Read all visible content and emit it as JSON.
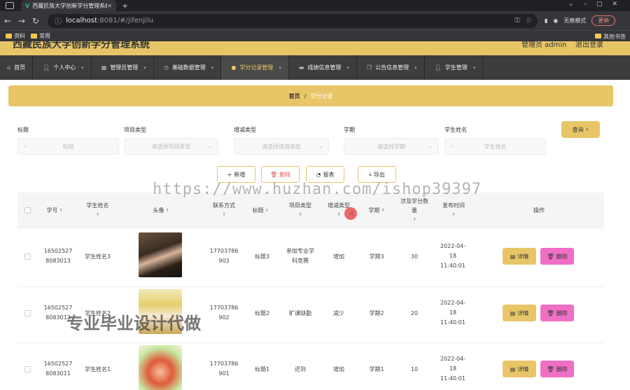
{
  "browser": {
    "tab_title": "西藏民族大学创新学分管理系统",
    "url_host": "localhost",
    "url_rest": ":8081/#/jifenjilu",
    "incognito": "无痕模式",
    "update": "更新",
    "bookmarks": [
      "资料",
      "常用"
    ],
    "other_bookmarks": "其他书签"
  },
  "header": {
    "title": "西藏民族大学创新学分管理系统",
    "user": "管理员 admin",
    "logout": "退出登录"
  },
  "menu": [
    {
      "icon": "home-icon",
      "label": "首页"
    },
    {
      "icon": "person-icon",
      "label": "个人中心"
    },
    {
      "icon": "grid-icon",
      "label": "管理员管理"
    },
    {
      "icon": "clock-icon",
      "label": "基础数据管理"
    },
    {
      "icon": "pin-icon",
      "label": "学分记录管理",
      "active": true
    },
    {
      "icon": "box-icon",
      "label": "成绩信息管理"
    },
    {
      "icon": "copy-icon",
      "label": "公告信息管理"
    },
    {
      "icon": "person-icon",
      "label": "学生管理"
    }
  ],
  "breadcrumb": {
    "home": "首页",
    "sep": "/",
    "current": "学分记录"
  },
  "filters": {
    "title_label": "标题",
    "title_ph": "标题",
    "type_label": "项目类型",
    "type_ph": "请选择项目类型",
    "change_label": "增减类型",
    "change_ph": "请选择增减类型",
    "term_label": "学期",
    "term_ph": "请选择学期",
    "name_label": "学生姓名",
    "name_ph": "学生姓名",
    "query": "查询"
  },
  "actions": {
    "add": "新增",
    "delete": "删除",
    "report": "报表",
    "export": "导出"
  },
  "columns": {
    "sno": "学号",
    "sname": "学生姓名",
    "avatar": "头像",
    "phone": "联系方式",
    "title": "标题",
    "ptype": "项目类型",
    "ctype": "增减类型",
    "term": "学期",
    "credits": "涉及学分数量",
    "time": "发布时间",
    "ops": "操作"
  },
  "rows": [
    {
      "sno": "16502527 8083013",
      "sname": "学生姓名3",
      "phone": "17703786 903",
      "title": "标题3",
      "ptype": "参加专业学科竞赛",
      "ctype": "增加",
      "term": "学期3",
      "credits": "30",
      "time": "2022-04-18 11:40:01"
    },
    {
      "sno": "16502527 8083012",
      "sname": "学生姓名2",
      "phone": "17703786 902",
      "title": "标题2",
      "ptype": "旷课缺勤",
      "ctype": "减少",
      "term": "学期2",
      "credits": "20",
      "time": "2022-04-18 11:40:01"
    },
    {
      "sno": "16502527 8083011",
      "sname": "学生姓名1",
      "phone": "17703786 901",
      "title": "标题1",
      "ptype": "迟到",
      "ctype": "增加",
      "term": "学期1",
      "credits": "10",
      "time": "2022-04-18 11:40:01"
    }
  ],
  "row_buttons": {
    "detail": "详情",
    "remove": "删除"
  },
  "watermark": "https://www.huzhan.com/ishop39397",
  "watermark2": "专业毕业设计代做"
}
